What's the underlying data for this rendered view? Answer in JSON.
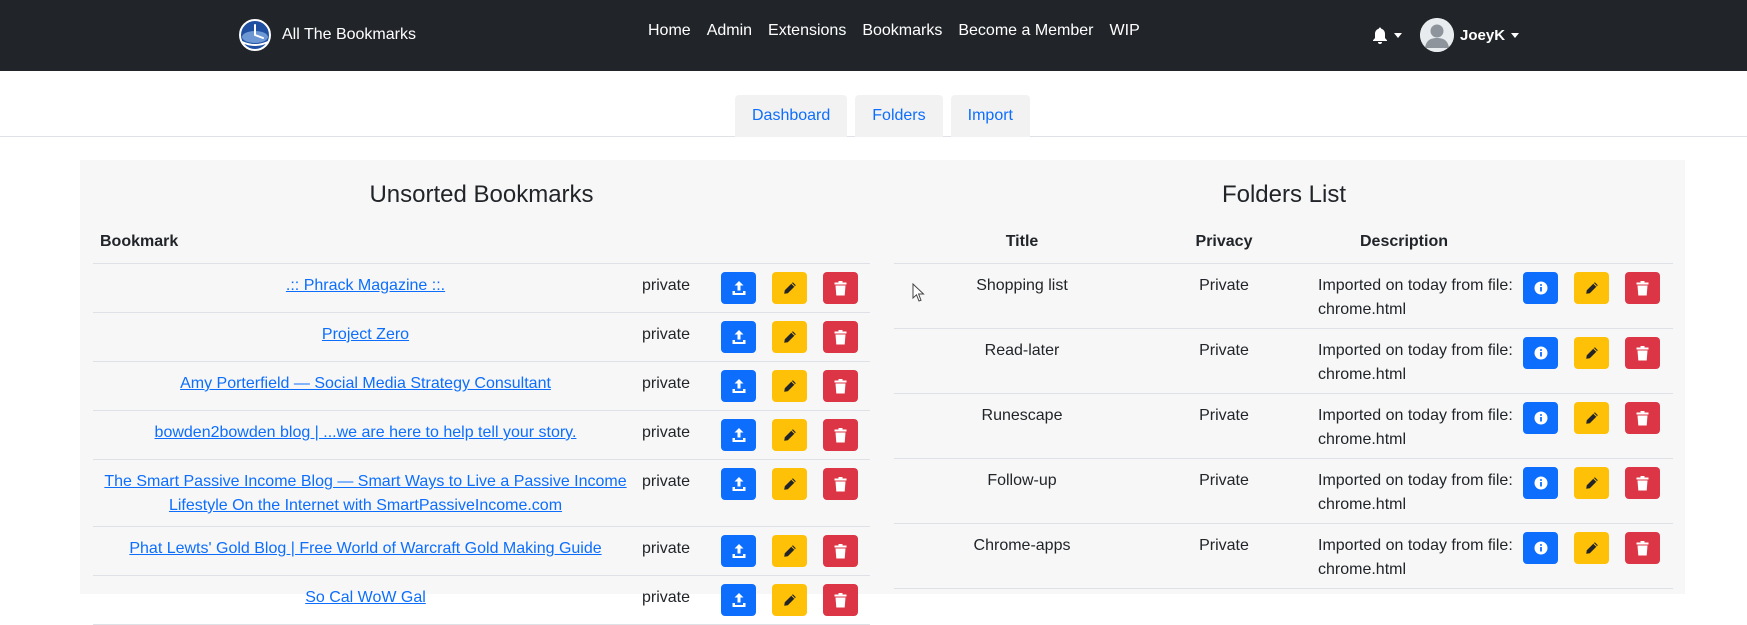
{
  "navbar": {
    "brand": "All The Bookmarks",
    "links": [
      "Home",
      "Admin",
      "Extensions",
      "Bookmarks",
      "Become a Member",
      "WIP"
    ],
    "user": "JoeyK",
    "icons": {
      "notifications": "bell-icon",
      "avatar": "user-avatar-icon"
    }
  },
  "tabs": [
    "Dashboard",
    "Folders",
    "Import"
  ],
  "unsorted": {
    "title": "Unsorted Bookmarks",
    "column": "Bookmark",
    "rows": [
      {
        "title": ".:: Phrack Magazine ::.",
        "privacy": "private"
      },
      {
        "title": "Project Zero",
        "privacy": "private"
      },
      {
        "title": "Amy Porterfield — Social Media Strategy Consultant",
        "privacy": "private"
      },
      {
        "title": "bowden2bowden blog | ...we are here to help tell your story.",
        "privacy": "private"
      },
      {
        "title": "The Smart Passive Income Blog — Smart Ways to Live a Passive Income Lifestyle On the Internet with SmartPassiveIncome.com",
        "privacy": "private"
      },
      {
        "title": "Phat Lewts' Gold Blog | Free World of Warcraft Gold Making Guide",
        "privacy": "private"
      },
      {
        "title": "So Cal WoW Gal",
        "privacy": "private"
      }
    ]
  },
  "folders": {
    "title": "Folders List",
    "columns": {
      "title": "Title",
      "privacy": "Privacy",
      "description": "Description"
    },
    "rows": [
      {
        "title": "Shopping list",
        "privacy": "Private",
        "description": "Imported on today from file: chrome.html"
      },
      {
        "title": "Read-later",
        "privacy": "Private",
        "description": "Imported on today from file: chrome.html"
      },
      {
        "title": "Runescape",
        "privacy": "Private",
        "description": "Imported on today from file: chrome.html"
      },
      {
        "title": "Follow-up",
        "privacy": "Private",
        "description": "Imported on today from file: chrome.html"
      },
      {
        "title": "Chrome-apps",
        "privacy": "Private",
        "description": "Imported on today from file: chrome.html"
      }
    ]
  },
  "colors": {
    "navbar": "#212529",
    "primary": "#0d6efd",
    "warning": "#ffc107",
    "danger": "#dc3545",
    "panel": "#f7f7f7"
  }
}
